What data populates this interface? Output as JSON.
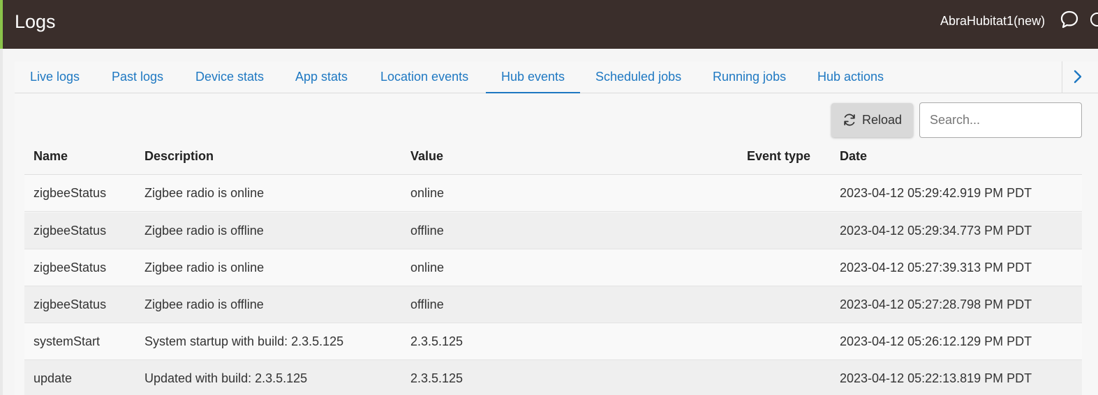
{
  "header": {
    "title": "Logs",
    "hub_name": "AbraHubitat1(new)",
    "icons": [
      "chat-icon",
      "help-icon"
    ]
  },
  "tabs": [
    {
      "label": "Live logs",
      "active": false
    },
    {
      "label": "Past logs",
      "active": false
    },
    {
      "label": "Device stats",
      "active": false
    },
    {
      "label": "App stats",
      "active": false
    },
    {
      "label": "Location events",
      "active": false
    },
    {
      "label": "Hub events",
      "active": true
    },
    {
      "label": "Scheduled jobs",
      "active": false
    },
    {
      "label": "Running jobs",
      "active": false
    },
    {
      "label": "Hub actions",
      "active": false
    }
  ],
  "toolbar": {
    "reload_label": "Reload",
    "search_placeholder": "Search..."
  },
  "table": {
    "columns": [
      "Name",
      "Description",
      "Value",
      "Event type",
      "Date"
    ],
    "rows": [
      {
        "name": "zigbeeStatus",
        "description": "Zigbee radio is online",
        "value": "online",
        "event_type": "",
        "date": "2023-04-12 05:29:42.919 PM PDT"
      },
      {
        "name": "zigbeeStatus",
        "description": "Zigbee radio is offline",
        "value": "offline",
        "event_type": "",
        "date": "2023-04-12 05:29:34.773 PM PDT"
      },
      {
        "name": "zigbeeStatus",
        "description": "Zigbee radio is online",
        "value": "online",
        "event_type": "",
        "date": "2023-04-12 05:27:39.313 PM PDT"
      },
      {
        "name": "zigbeeStatus",
        "description": "Zigbee radio is offline",
        "value": "offline",
        "event_type": "",
        "date": "2023-04-12 05:27:28.798 PM PDT"
      },
      {
        "name": "systemStart",
        "description": "System startup with build: 2.3.5.125",
        "value": "2.3.5.125",
        "event_type": "",
        "date": "2023-04-12 05:26:12.129 PM PDT"
      },
      {
        "name": "update",
        "description": "Updated with build: 2.3.5.125",
        "value": "2.3.5.125",
        "event_type": "",
        "date": "2023-04-12 05:22:13.819 PM PDT"
      }
    ]
  },
  "colors": {
    "header_bg": "#3a2e2b",
    "accent": "#8bc34a",
    "link": "#1e78c2"
  }
}
